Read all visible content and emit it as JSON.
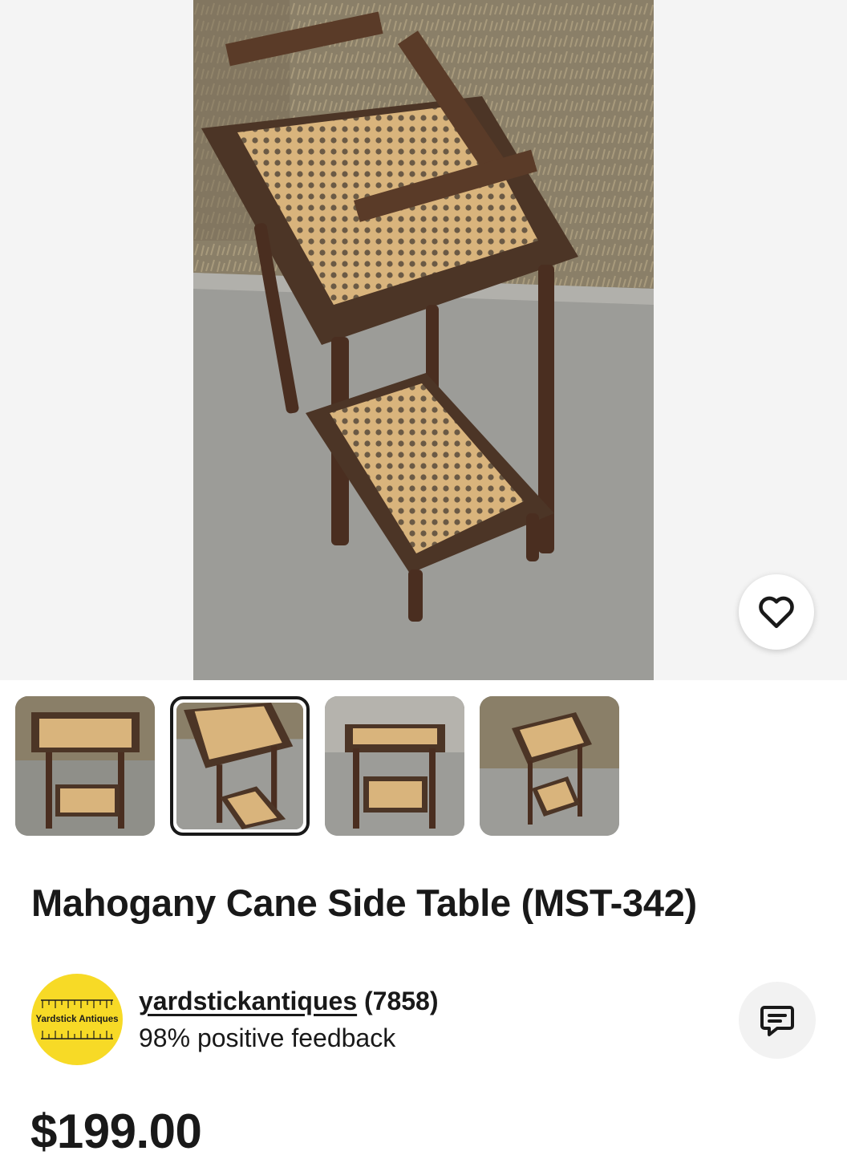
{
  "listing": {
    "title": "Mahogany Cane Side Table (MST-342)",
    "price": "$199.00"
  },
  "gallery": {
    "main_image": "cane-side-table-photo-2",
    "thumbnails": [
      {
        "name": "thumbnail-1",
        "selected": false
      },
      {
        "name": "thumbnail-2",
        "selected": true
      },
      {
        "name": "thumbnail-3",
        "selected": false
      },
      {
        "name": "thumbnail-4",
        "selected": false
      }
    ],
    "favorite_icon": "heart-outline-icon"
  },
  "seller": {
    "logo_text": "Yardstick Antiques",
    "username": "yardstickantiques",
    "rating_count": "(7858)",
    "feedback": "98% positive feedback",
    "message_icon": "message-bubble-icon"
  },
  "colors": {
    "text": "#191919",
    "logo_yellow": "#f7da26",
    "message_button_bg": "#f2f2f2"
  }
}
